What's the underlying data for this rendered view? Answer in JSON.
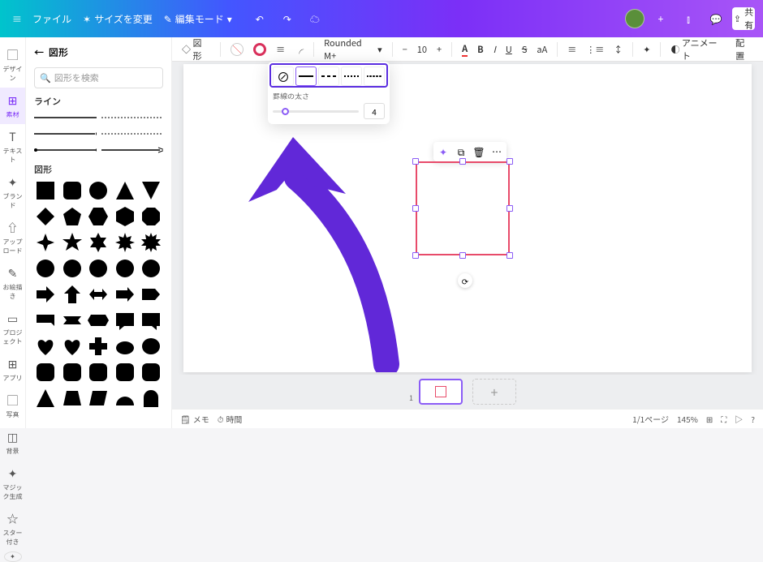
{
  "topbar": {
    "file": "ファイル",
    "resize": "サイズを変更",
    "edit_mode": "編集モード",
    "share": "共有"
  },
  "leftrail": {
    "items": [
      {
        "icon": "▢",
        "label": "デザイン"
      },
      {
        "icon": "⊞",
        "label": "素材"
      },
      {
        "icon": "T",
        "label": "テキスト"
      },
      {
        "icon": "✦",
        "label": "ブランド"
      },
      {
        "icon": "⇧",
        "label": "アップロード"
      },
      {
        "icon": "✎",
        "label": "お絵描き"
      },
      {
        "icon": "▭",
        "label": "プロジェクト"
      },
      {
        "icon": "⊞",
        "label": "アプリ"
      },
      {
        "icon": "▢",
        "label": "写真"
      },
      {
        "icon": "◫",
        "label": "背景"
      },
      {
        "icon": "✦",
        "label": "マジック生成"
      },
      {
        "icon": "☆",
        "label": "スター付き"
      }
    ]
  },
  "sidepanel": {
    "title": "図形",
    "search_placeholder": "図形を検索",
    "section_lines": "ライン",
    "section_shapes": "図形"
  },
  "ctxbar": {
    "shape": "図形",
    "font": "Rounded M+",
    "size": "10",
    "animate": "アニメート",
    "position": "配置"
  },
  "linepop": {
    "label": "罫線の太さ",
    "value": "4"
  },
  "pagebar": {
    "page": "1"
  },
  "status": {
    "memo": "メモ",
    "time": "時間",
    "pages": "1/1ページ",
    "zoom": "145%"
  }
}
